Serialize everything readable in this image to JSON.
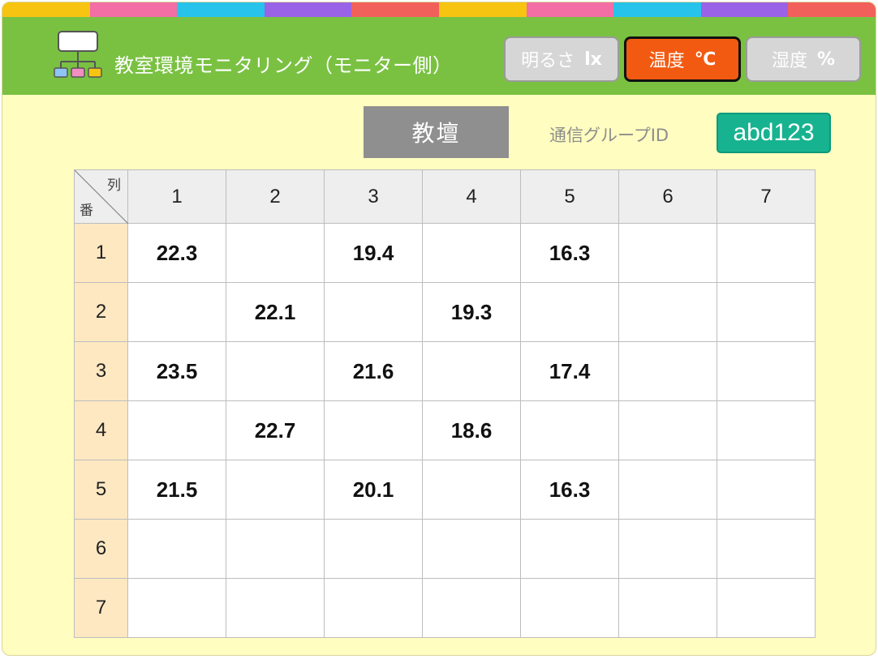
{
  "stripe_colors": [
    "#f7c411",
    "#f26ea5",
    "#28c3ea",
    "#9a62e6",
    "#f2605c",
    "#f7c411",
    "#f26ea5",
    "#28c3ea",
    "#9a62e6",
    "#f2605c"
  ],
  "header": {
    "title": "教室環境モニタリング（モニター側）",
    "logo_icon": "network-tree-icon"
  },
  "modes": [
    {
      "label": "明るさ",
      "unit": "lx",
      "active": false
    },
    {
      "label": "温度",
      "unit": "℃",
      "active": true
    },
    {
      "label": "湿度",
      "unit": "%",
      "active": false
    }
  ],
  "lectern_label": "教壇",
  "group": {
    "label": "通信グループID",
    "id": "abd123"
  },
  "table": {
    "corner_col_label": "列",
    "corner_row_label": "番",
    "columns": [
      "1",
      "2",
      "3",
      "4",
      "5",
      "6",
      "7"
    ],
    "rows": [
      {
        "label": "1",
        "cells": [
          "22.3",
          "",
          "19.4",
          "",
          "16.3",
          "",
          ""
        ]
      },
      {
        "label": "2",
        "cells": [
          "",
          "22.1",
          "",
          "19.3",
          "",
          "",
          ""
        ]
      },
      {
        "label": "3",
        "cells": [
          "23.5",
          "",
          "21.6",
          "",
          "17.4",
          "",
          ""
        ]
      },
      {
        "label": "4",
        "cells": [
          "",
          "22.7",
          "",
          "18.6",
          "",
          "",
          ""
        ]
      },
      {
        "label": "5",
        "cells": [
          "21.5",
          "",
          "20.1",
          "",
          "16.3",
          "",
          ""
        ]
      },
      {
        "label": "6",
        "cells": [
          "",
          "",
          "",
          "",
          "",
          "",
          ""
        ]
      },
      {
        "label": "7",
        "cells": [
          "",
          "",
          "",
          "",
          "",
          "",
          ""
        ]
      }
    ]
  },
  "colors": {
    "header_bg": "#7ac142",
    "body_bg": "#fffdc0",
    "active_button": "#f25a12",
    "group_id_bg": "#17b390",
    "row_header_bg": "#fde8c2"
  }
}
